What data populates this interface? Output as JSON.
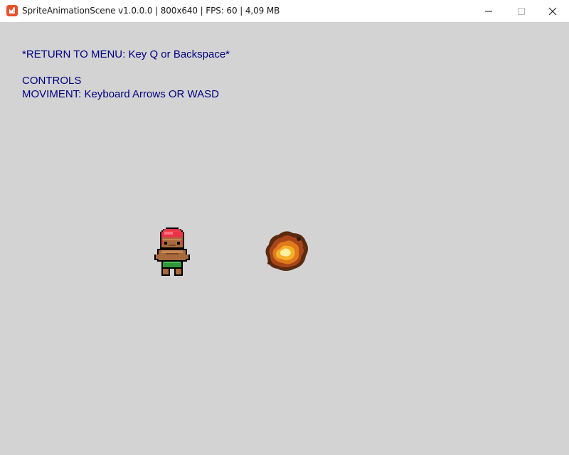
{
  "window": {
    "title": "SpriteAnimationScene v1.0.0.0 | 800x640 | FPS: 60 | 4,09 MB",
    "app_icon": "monogame-logo-icon",
    "icon_color": "#e7512b",
    "controls": {
      "minimize_icon": "minimize-icon",
      "maximize_icon": "maximize-icon",
      "close_icon": "close-icon"
    }
  },
  "scene": {
    "background_color": "#d3d3d3",
    "text_color": "#000080",
    "hud": {
      "return_to_menu": "*RETURN TO MENU: Key Q or Backspace*",
      "controls_heading": "CONTROLS",
      "movement": "MOVIMENT: Keyboard Arrows OR WASD"
    },
    "sprites": {
      "player": "player-character-sprite",
      "fire": "fire-explosion-sprite"
    }
  }
}
